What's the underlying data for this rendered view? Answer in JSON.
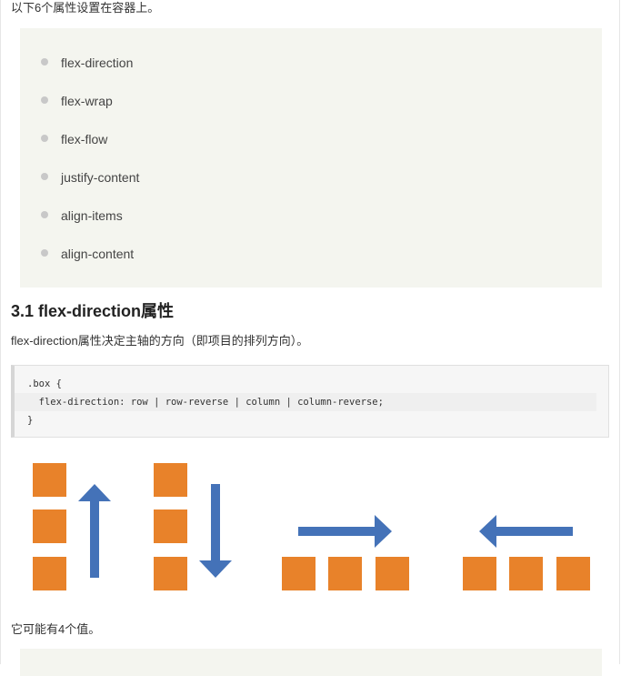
{
  "intro_text": "以下6个属性设置在容器上。",
  "properties": [
    "flex-direction",
    "flex-wrap",
    "flex-flow",
    "justify-content",
    "align-items",
    "align-content"
  ],
  "section_title": "3.1 flex-direction属性",
  "description": "flex-direction属性决定主轴的方向（即项目的排列方向）。",
  "code": [
    ".box {",
    "  flex-direction: row | row-reverse | column | column-reverse;",
    "}"
  ],
  "closing_text": "它可能有4个值。",
  "colors": {
    "item_orange": "#e8822a",
    "arrow_blue": "#4472b8"
  },
  "diagram_panels": [
    "column",
    "column-reverse",
    "row",
    "row-reverse"
  ]
}
